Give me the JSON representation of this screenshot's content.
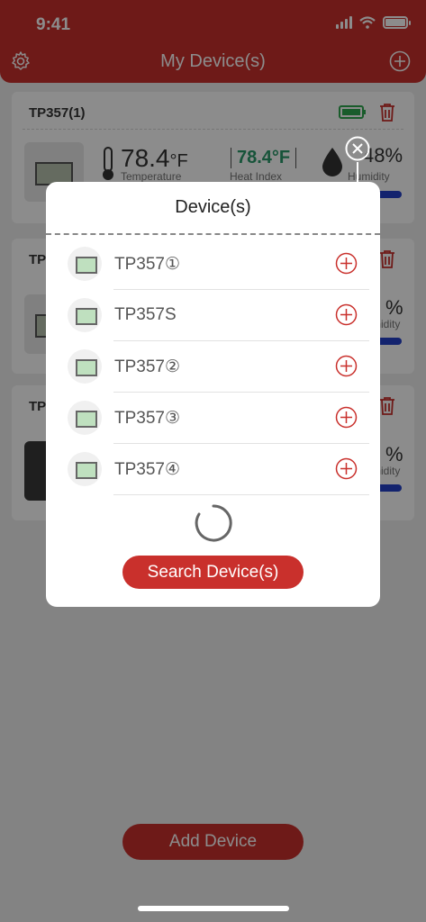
{
  "status_bar": {
    "time": "9:41"
  },
  "header": {
    "title": "My Device(s)"
  },
  "cards": [
    {
      "title": "TP357(1)",
      "temperature": "78.4",
      "temp_unit": "°F",
      "temperature_label": "Temperature",
      "heat_index": "78.4°F",
      "heat_index_label": "Heat Index",
      "humidity": "48%",
      "humidity_label": "Humidity"
    },
    {
      "title": "TP",
      "humidity": "%",
      "humidity_label": "midity"
    },
    {
      "title": "TP",
      "humidity": "%",
      "humidity_label": "midity"
    }
  ],
  "bottom": {
    "add_device_label": "Add Device"
  },
  "modal": {
    "title": "Device(s)",
    "devices": [
      {
        "name": "TP357①"
      },
      {
        "name": "TP357S"
      },
      {
        "name": "TP357②"
      },
      {
        "name": "TP357③"
      },
      {
        "name": "TP357④"
      }
    ],
    "search_label": "Search Device(s)"
  },
  "colors": {
    "brand_red": "#c9302c",
    "heat_green": "#2a9a6a",
    "battery_green": "#2fa84f",
    "humidity_blue": "#2440c8"
  }
}
